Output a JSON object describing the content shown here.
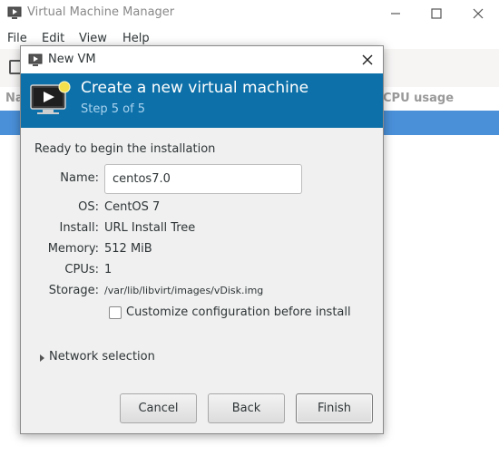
{
  "main_window": {
    "title": "Virtual Machine Manager",
    "menu": [
      "File",
      "Edit",
      "View",
      "Help"
    ],
    "list_header": {
      "name_col": "Na",
      "cpu_col": "CPU usage"
    }
  },
  "dialog": {
    "title": "New VM",
    "banner": {
      "title": "Create a new virtual machine",
      "step": "Step 5 of 5"
    },
    "ready_label": "Ready to begin the installation",
    "fields": {
      "name_label": "Name:",
      "name_value": "centos7.0",
      "os_label": "OS:",
      "os_value": "CentOS 7",
      "install_label": "Install:",
      "install_value": "URL Install Tree",
      "memory_label": "Memory:",
      "memory_value": "512 MiB",
      "cpus_label": "CPUs:",
      "cpus_value": "1",
      "storage_label": "Storage:",
      "storage_value": "/var/lib/libvirt/images/vDisk.img"
    },
    "customize_label": "Customize configuration before install",
    "customize_checked": false,
    "network_selection_label": "Network selection",
    "buttons": {
      "cancel": "Cancel",
      "back": "Back",
      "finish": "Finish"
    }
  },
  "colors": {
    "banner_bg": "#0d70a8",
    "selection": "#4a90d9",
    "dialog_bg": "#f0f0f0"
  },
  "icons": [
    "vm-monitor-icon",
    "minimize-icon",
    "maximize-icon",
    "close-icon",
    "expander-arrow-icon"
  ]
}
